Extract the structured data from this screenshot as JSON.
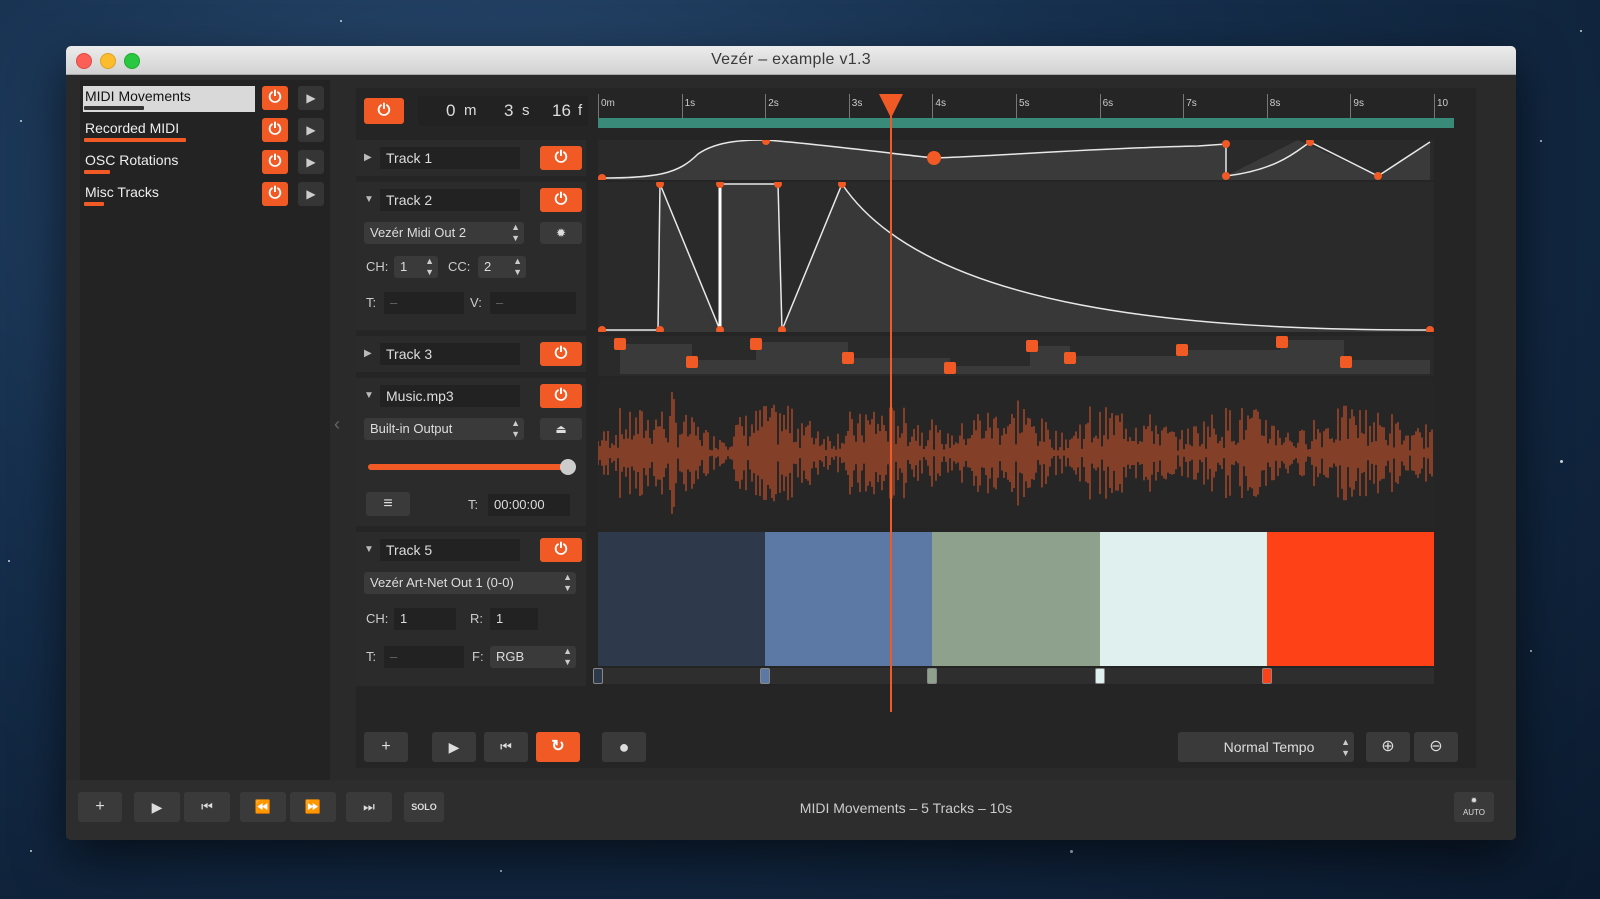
{
  "window": {
    "title": "Vezér – example v1.3"
  },
  "playlist": {
    "items": [
      {
        "name": "MIDI Movements",
        "selected": true,
        "progress": 0.35
      },
      {
        "name": "Recorded MIDI",
        "selected": false,
        "progress": 0.6
      },
      {
        "name": "OSC Rotations",
        "selected": false,
        "progress": 0.15
      },
      {
        "name": "Misc Tracks",
        "selected": false,
        "progress": 0.12
      }
    ]
  },
  "timecode": {
    "minutes": "0",
    "m_unit": "m",
    "seconds": "3",
    "s_unit": "s",
    "frames": "16",
    "f_unit": "f"
  },
  "ruler": {
    "labels": [
      "0m",
      "1s",
      "2s",
      "3s",
      "4s",
      "5s",
      "6s",
      "7s",
      "8s",
      "9s",
      "10"
    ],
    "playhead_seconds": 3.5,
    "duration_seconds": 10
  },
  "tracks": {
    "track1": {
      "name": "Track 1"
    },
    "track2": {
      "name": "Track 2",
      "output": "Vezér Midi Out 2",
      "ch_label": "CH:",
      "ch_value": "1",
      "cc_label": "CC:",
      "cc_value": "2",
      "t_label": "T:",
      "t_value": "–",
      "v_label": "V:",
      "v_value": "–"
    },
    "track3": {
      "name": "Track 3"
    },
    "track4": {
      "name": "Music.mp3",
      "output": "Built-in Output",
      "volume": 0.97,
      "t_label": "T:",
      "t_value": "00:00:00"
    },
    "track5": {
      "name": "Track 5",
      "output": "Vezér Art-Net Out 1 (0-0)",
      "ch_label": "CH:",
      "ch_value": "1",
      "r_label": "R:",
      "r_value": "1",
      "t_label": "T:",
      "t_value": "–",
      "f_label": "F:",
      "f_value": "RGB",
      "colors": [
        "#2e3a4c",
        "#5b79a4",
        "#8da18c",
        "#dff0ee",
        "#ff4117"
      ]
    }
  },
  "transport": {
    "tempo": "Normal Tempo"
  },
  "status": {
    "text": "MIDI Movements – 5 Tracks – 10s",
    "solo_label": "SOLO",
    "auto_label": "AUTO"
  },
  "colors": {
    "accent": "#f15a24",
    "background": "#2a2a2a"
  }
}
